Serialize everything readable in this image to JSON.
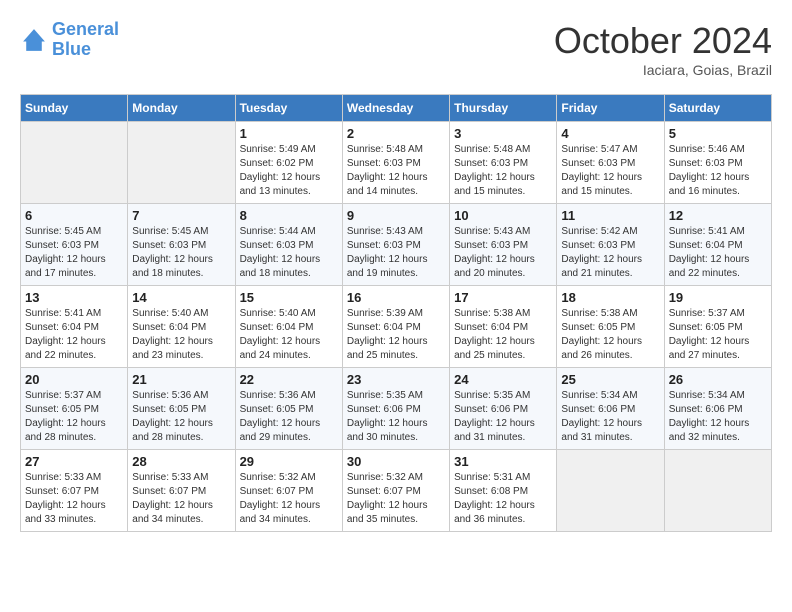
{
  "logo": {
    "line1": "General",
    "line2": "Blue"
  },
  "title": "October 2024",
  "subtitle": "Iaciara, Goias, Brazil",
  "days_of_week": [
    "Sunday",
    "Monday",
    "Tuesday",
    "Wednesday",
    "Thursday",
    "Friday",
    "Saturday"
  ],
  "weeks": [
    [
      {
        "day": "",
        "sunrise": "",
        "sunset": "",
        "daylight": ""
      },
      {
        "day": "",
        "sunrise": "",
        "sunset": "",
        "daylight": ""
      },
      {
        "day": "1",
        "sunrise": "Sunrise: 5:49 AM",
        "sunset": "Sunset: 6:02 PM",
        "daylight": "Daylight: 12 hours and 13 minutes."
      },
      {
        "day": "2",
        "sunrise": "Sunrise: 5:48 AM",
        "sunset": "Sunset: 6:03 PM",
        "daylight": "Daylight: 12 hours and 14 minutes."
      },
      {
        "day": "3",
        "sunrise": "Sunrise: 5:48 AM",
        "sunset": "Sunset: 6:03 PM",
        "daylight": "Daylight: 12 hours and 15 minutes."
      },
      {
        "day": "4",
        "sunrise": "Sunrise: 5:47 AM",
        "sunset": "Sunset: 6:03 PM",
        "daylight": "Daylight: 12 hours and 15 minutes."
      },
      {
        "day": "5",
        "sunrise": "Sunrise: 5:46 AM",
        "sunset": "Sunset: 6:03 PM",
        "daylight": "Daylight: 12 hours and 16 minutes."
      }
    ],
    [
      {
        "day": "6",
        "sunrise": "Sunrise: 5:45 AM",
        "sunset": "Sunset: 6:03 PM",
        "daylight": "Daylight: 12 hours and 17 minutes."
      },
      {
        "day": "7",
        "sunrise": "Sunrise: 5:45 AM",
        "sunset": "Sunset: 6:03 PM",
        "daylight": "Daylight: 12 hours and 18 minutes."
      },
      {
        "day": "8",
        "sunrise": "Sunrise: 5:44 AM",
        "sunset": "Sunset: 6:03 PM",
        "daylight": "Daylight: 12 hours and 18 minutes."
      },
      {
        "day": "9",
        "sunrise": "Sunrise: 5:43 AM",
        "sunset": "Sunset: 6:03 PM",
        "daylight": "Daylight: 12 hours and 19 minutes."
      },
      {
        "day": "10",
        "sunrise": "Sunrise: 5:43 AM",
        "sunset": "Sunset: 6:03 PM",
        "daylight": "Daylight: 12 hours and 20 minutes."
      },
      {
        "day": "11",
        "sunrise": "Sunrise: 5:42 AM",
        "sunset": "Sunset: 6:03 PM",
        "daylight": "Daylight: 12 hours and 21 minutes."
      },
      {
        "day": "12",
        "sunrise": "Sunrise: 5:41 AM",
        "sunset": "Sunset: 6:04 PM",
        "daylight": "Daylight: 12 hours and 22 minutes."
      }
    ],
    [
      {
        "day": "13",
        "sunrise": "Sunrise: 5:41 AM",
        "sunset": "Sunset: 6:04 PM",
        "daylight": "Daylight: 12 hours and 22 minutes."
      },
      {
        "day": "14",
        "sunrise": "Sunrise: 5:40 AM",
        "sunset": "Sunset: 6:04 PM",
        "daylight": "Daylight: 12 hours and 23 minutes."
      },
      {
        "day": "15",
        "sunrise": "Sunrise: 5:40 AM",
        "sunset": "Sunset: 6:04 PM",
        "daylight": "Daylight: 12 hours and 24 minutes."
      },
      {
        "day": "16",
        "sunrise": "Sunrise: 5:39 AM",
        "sunset": "Sunset: 6:04 PM",
        "daylight": "Daylight: 12 hours and 25 minutes."
      },
      {
        "day": "17",
        "sunrise": "Sunrise: 5:38 AM",
        "sunset": "Sunset: 6:04 PM",
        "daylight": "Daylight: 12 hours and 25 minutes."
      },
      {
        "day": "18",
        "sunrise": "Sunrise: 5:38 AM",
        "sunset": "Sunset: 6:05 PM",
        "daylight": "Daylight: 12 hours and 26 minutes."
      },
      {
        "day": "19",
        "sunrise": "Sunrise: 5:37 AM",
        "sunset": "Sunset: 6:05 PM",
        "daylight": "Daylight: 12 hours and 27 minutes."
      }
    ],
    [
      {
        "day": "20",
        "sunrise": "Sunrise: 5:37 AM",
        "sunset": "Sunset: 6:05 PM",
        "daylight": "Daylight: 12 hours and 28 minutes."
      },
      {
        "day": "21",
        "sunrise": "Sunrise: 5:36 AM",
        "sunset": "Sunset: 6:05 PM",
        "daylight": "Daylight: 12 hours and 28 minutes."
      },
      {
        "day": "22",
        "sunrise": "Sunrise: 5:36 AM",
        "sunset": "Sunset: 6:05 PM",
        "daylight": "Daylight: 12 hours and 29 minutes."
      },
      {
        "day": "23",
        "sunrise": "Sunrise: 5:35 AM",
        "sunset": "Sunset: 6:06 PM",
        "daylight": "Daylight: 12 hours and 30 minutes."
      },
      {
        "day": "24",
        "sunrise": "Sunrise: 5:35 AM",
        "sunset": "Sunset: 6:06 PM",
        "daylight": "Daylight: 12 hours and 31 minutes."
      },
      {
        "day": "25",
        "sunrise": "Sunrise: 5:34 AM",
        "sunset": "Sunset: 6:06 PM",
        "daylight": "Daylight: 12 hours and 31 minutes."
      },
      {
        "day": "26",
        "sunrise": "Sunrise: 5:34 AM",
        "sunset": "Sunset: 6:06 PM",
        "daylight": "Daylight: 12 hours and 32 minutes."
      }
    ],
    [
      {
        "day": "27",
        "sunrise": "Sunrise: 5:33 AM",
        "sunset": "Sunset: 6:07 PM",
        "daylight": "Daylight: 12 hours and 33 minutes."
      },
      {
        "day": "28",
        "sunrise": "Sunrise: 5:33 AM",
        "sunset": "Sunset: 6:07 PM",
        "daylight": "Daylight: 12 hours and 34 minutes."
      },
      {
        "day": "29",
        "sunrise": "Sunrise: 5:32 AM",
        "sunset": "Sunset: 6:07 PM",
        "daylight": "Daylight: 12 hours and 34 minutes."
      },
      {
        "day": "30",
        "sunrise": "Sunrise: 5:32 AM",
        "sunset": "Sunset: 6:07 PM",
        "daylight": "Daylight: 12 hours and 35 minutes."
      },
      {
        "day": "31",
        "sunrise": "Sunrise: 5:31 AM",
        "sunset": "Sunset: 6:08 PM",
        "daylight": "Daylight: 12 hours and 36 minutes."
      },
      {
        "day": "",
        "sunrise": "",
        "sunset": "",
        "daylight": ""
      },
      {
        "day": "",
        "sunrise": "",
        "sunset": "",
        "daylight": ""
      }
    ]
  ]
}
